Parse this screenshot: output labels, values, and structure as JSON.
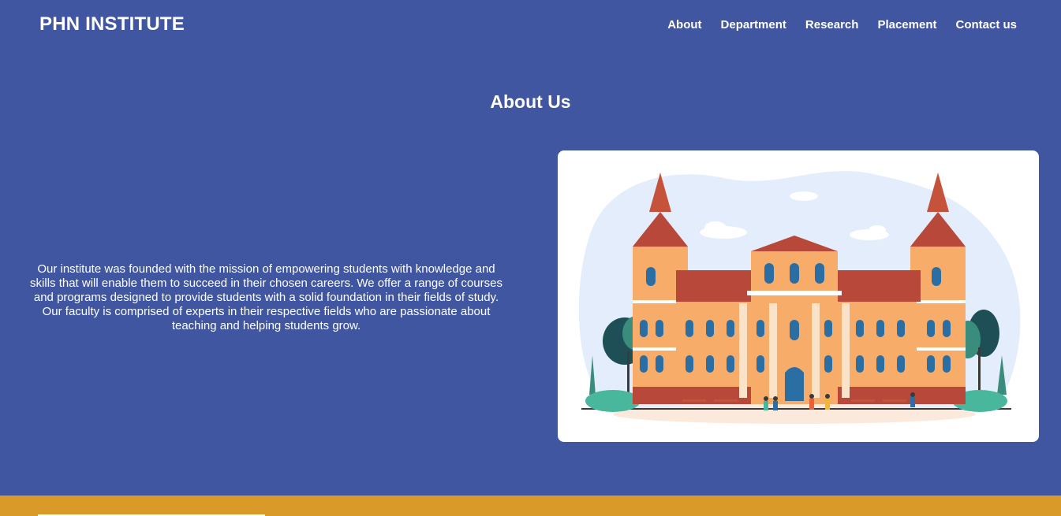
{
  "header": {
    "brand": "PHN INSTITUTE",
    "nav": [
      "About",
      "Department",
      "Research",
      "Placement",
      "Contact us"
    ]
  },
  "about": {
    "title": "About Us",
    "text": "Our institute was founded with the mission of empowering students with knowledge and skills that will enable them to succeed in their chosen careers. We offer a range of courses and programs designed to provide students with a solid foundation in their fields of study. Our faculty is comprised of experts in their respective fields who are passionate about teaching and helping students grow."
  },
  "colors": {
    "background": "#4056a1",
    "footer_accent": "#d99a29",
    "text": "#ffffff"
  }
}
